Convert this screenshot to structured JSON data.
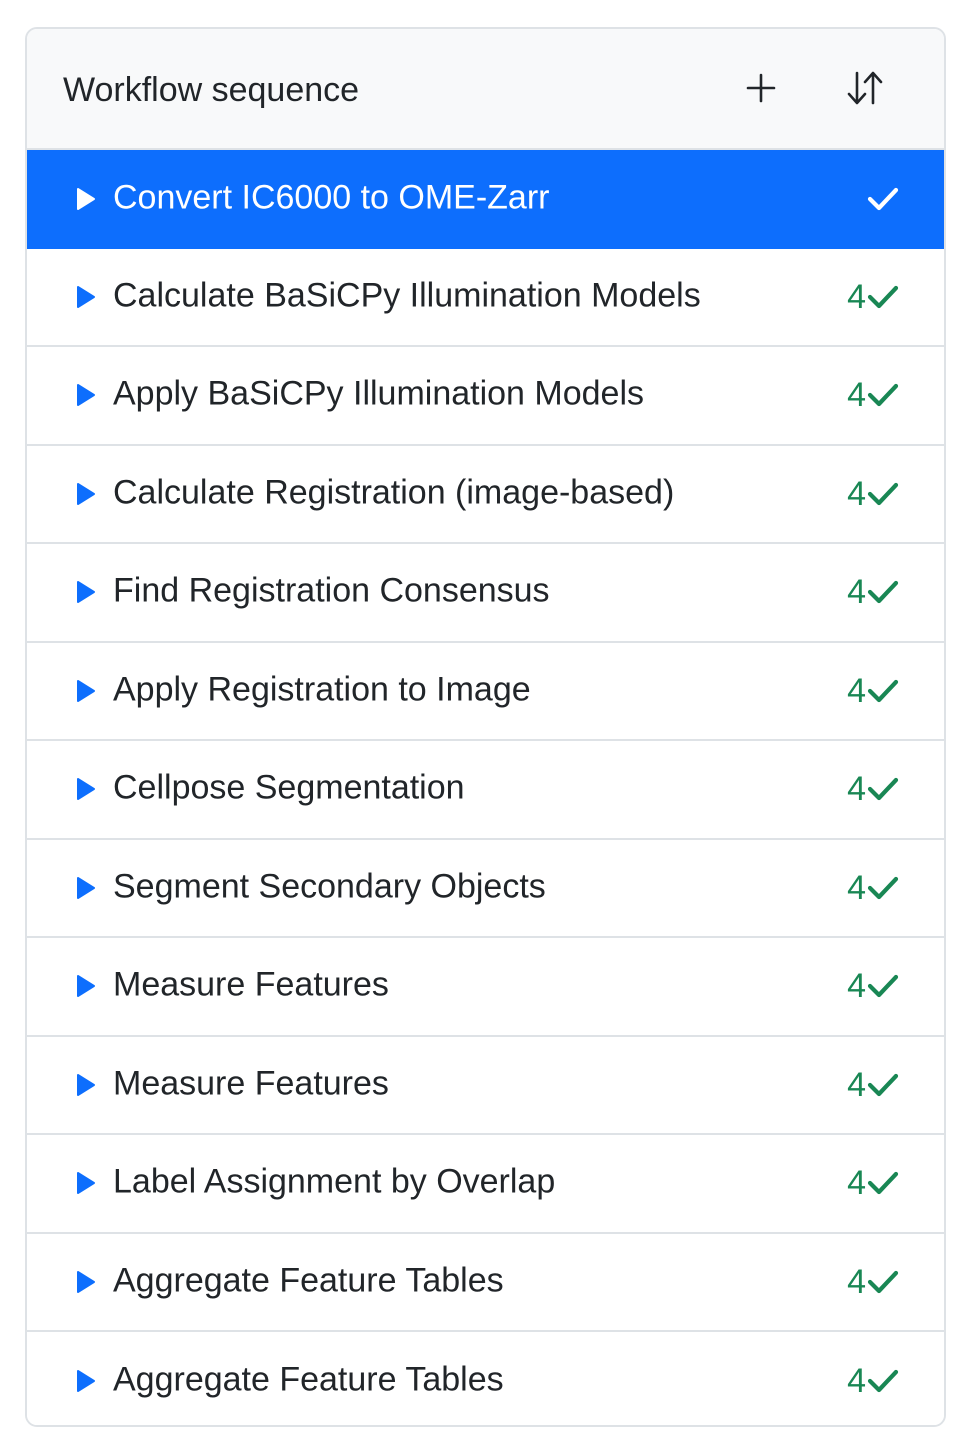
{
  "header": {
    "title": "Workflow sequence",
    "add_icon": "plus-icon",
    "sort_icon": "sort-arrows-icon"
  },
  "colors": {
    "accent": "#0d6efd",
    "success": "#198754",
    "border": "#dee2e6",
    "header_bg": "#f8f9fa",
    "text": "#212529"
  },
  "tasks": [
    {
      "label": "Convert IC6000 to OME-Zarr",
      "count": "",
      "status_icon": "check-icon",
      "active": true
    },
    {
      "label": "Calculate BaSiCPy Illumination Models",
      "count": "4",
      "status_icon": "check-icon",
      "active": false
    },
    {
      "label": "Apply BaSiCPy Illumination Models",
      "count": "4",
      "status_icon": "check-icon",
      "active": false
    },
    {
      "label": "Calculate Registration (image-based)",
      "count": "4",
      "status_icon": "check-icon",
      "active": false
    },
    {
      "label": "Find Registration Consensus",
      "count": "4",
      "status_icon": "check-icon",
      "active": false
    },
    {
      "label": "Apply Registration to Image",
      "count": "4",
      "status_icon": "check-icon",
      "active": false
    },
    {
      "label": "Cellpose Segmentation",
      "count": "4",
      "status_icon": "check-icon",
      "active": false
    },
    {
      "label": "Segment Secondary Objects",
      "count": "4",
      "status_icon": "check-icon",
      "active": false
    },
    {
      "label": "Measure Features",
      "count": "4",
      "status_icon": "check-icon",
      "active": false
    },
    {
      "label": "Measure Features",
      "count": "4",
      "status_icon": "check-icon",
      "active": false
    },
    {
      "label": "Label Assignment by Overlap",
      "count": "4",
      "status_icon": "check-icon",
      "active": false
    },
    {
      "label": "Aggregate Feature Tables",
      "count": "4",
      "status_icon": "check-icon",
      "active": false
    },
    {
      "label": "Aggregate Feature Tables",
      "count": "4",
      "status_icon": "check-icon",
      "active": false
    }
  ]
}
